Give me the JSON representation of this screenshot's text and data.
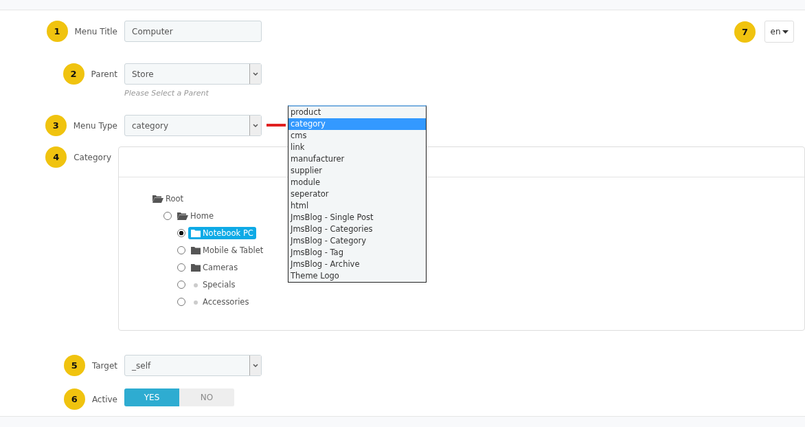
{
  "language": {
    "badge": "7",
    "value": "en"
  },
  "fields": [
    {
      "kind": "text",
      "badge": "1",
      "label": "Menu Title",
      "value": "Computer"
    },
    {
      "kind": "select",
      "badge": "2",
      "label": "Parent",
      "value": "Store",
      "help": "Please Select a Parent"
    },
    {
      "kind": "select",
      "badge": "3",
      "label": "Menu Type",
      "value": "category",
      "dropdown": {
        "options": [
          {
            "label": "product",
            "selected": false
          },
          {
            "label": "category",
            "selected": true
          },
          {
            "label": "cms",
            "selected": false
          },
          {
            "label": "link",
            "selected": false
          },
          {
            "label": "manufacturer",
            "selected": false
          },
          {
            "label": "supplier",
            "selected": false
          },
          {
            "label": "module",
            "selected": false
          },
          {
            "label": "seperator",
            "selected": false
          },
          {
            "label": "html",
            "selected": false
          },
          {
            "label": "JmsBlog - Single Post",
            "selected": false
          },
          {
            "label": "JmsBlog - Categories",
            "selected": false
          },
          {
            "label": "JmsBlog - Category",
            "selected": false
          },
          {
            "label": "JmsBlog - Tag",
            "selected": false
          },
          {
            "label": "JmsBlog - Archive",
            "selected": false
          },
          {
            "label": "Theme Logo",
            "selected": false
          }
        ]
      }
    },
    {
      "kind": "tree",
      "badge": "4",
      "label": "Category",
      "tree": [
        {
          "kind": "root",
          "label": "Root",
          "expanded": true,
          "children": [
            {
              "kind": "folder",
              "label": "Home",
              "expanded": true,
              "selected": false,
              "children": [
                {
                  "kind": "folder",
                  "label": "Notebook PC",
                  "expanded": false,
                  "selected": true
                },
                {
                  "kind": "folder",
                  "label": "Mobile & Tablet",
                  "expanded": false,
                  "selected": false
                },
                {
                  "kind": "folder",
                  "label": "Cameras",
                  "expanded": false,
                  "selected": false
                },
                {
                  "kind": "leaf",
                  "label": "Specials",
                  "selected": false
                },
                {
                  "kind": "leaf",
                  "label": "Accessories",
                  "selected": false
                }
              ]
            }
          ]
        }
      ]
    },
    {
      "kind": "select",
      "badge": "5",
      "label": "Target",
      "value": "_self"
    },
    {
      "kind": "switch",
      "badge": "6",
      "label": "Active",
      "options": [
        {
          "label": "YES",
          "selected": true
        },
        {
          "label": "NO",
          "selected": false
        }
      ]
    }
  ]
}
